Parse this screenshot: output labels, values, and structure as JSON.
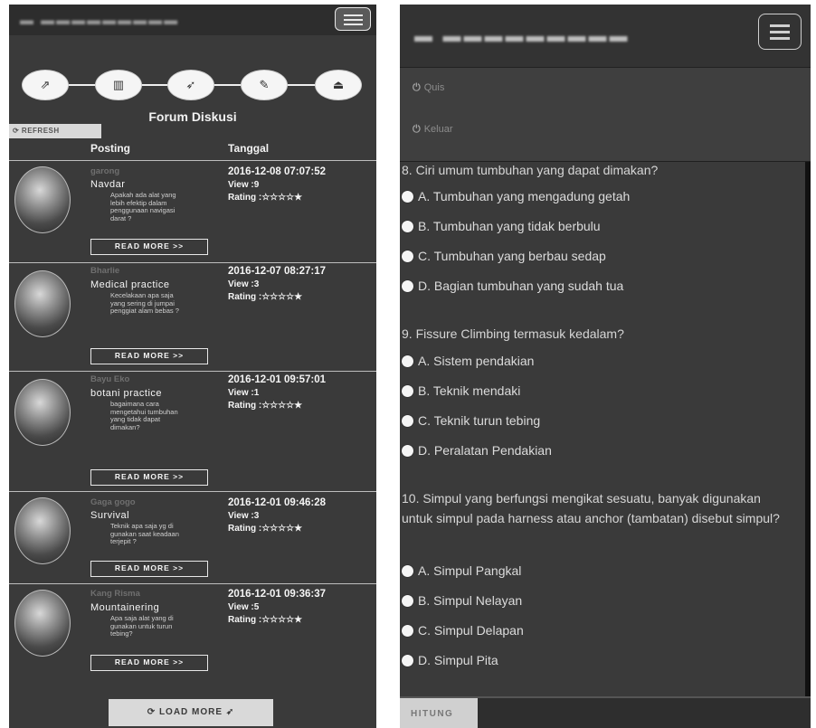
{
  "forum": {
    "menu_icon": "hamburger-icon",
    "steps": [
      {
        "icon": "folder-open-icon",
        "glyph": "⇗"
      },
      {
        "icon": "bank-icon",
        "glyph": "▥"
      },
      {
        "icon": "paper-plane-icon",
        "glyph": "➶"
      },
      {
        "icon": "pencil-icon",
        "glyph": "✎"
      },
      {
        "icon": "eject-icon",
        "glyph": "⏏"
      }
    ],
    "title": "Forum Diskusi",
    "refresh_label": "⟳ REFRESH",
    "col_posting": "Posting",
    "col_tanggal": "Tanggal",
    "posts": [
      {
        "author": "garong",
        "title": "Navdar",
        "body": "Apakah ada alat yang lebih efektip dalam penggunaan navigasi darat ?",
        "date": "2016-12-08 07:07:52",
        "view": "View :9",
        "rating": "Rating :☆☆☆☆★",
        "read_more": "READ MORE >>"
      },
      {
        "author": "Bharlie",
        "title": "Medical practice",
        "body": "Kecelakaan apa saja yang sering di jumpai penggiat alam bebas ?",
        "date": "2016-12-07 08:27:17",
        "view": "View :3",
        "rating": "Rating :☆☆☆☆★",
        "read_more": "READ MORE >>"
      },
      {
        "author": "Bayu Eko",
        "title": "botani practice",
        "body": "bagaimana cara mengetahui tumbuhan yang tidak dapat dimakan?",
        "date": "2016-12-01 09:57:01",
        "view": "View :1",
        "rating": "Rating :☆☆☆☆★",
        "read_more": "READ MORE >>"
      },
      {
        "author": "Gaga gogo",
        "title": "Survival",
        "body": "Teknik apa saja yg di gunakan saat keadaan terjepit ?",
        "date": "2016-12-01 09:46:28",
        "view": "View :3",
        "rating": "Rating :☆☆☆☆★",
        "read_more": "READ MORE >>"
      },
      {
        "author": "Kang Risma",
        "title": "Mountainering",
        "body": "Apa saja alat yang di gunakan untuk turun tebing?",
        "date": "2016-12-01 09:36:37",
        "view": "View :5",
        "rating": "Rating :☆☆☆☆★",
        "read_more": "READ MORE >>"
      }
    ],
    "load_more": "⟳ LOAD MORE ➶"
  },
  "quiz": {
    "menu_icon": "hamburger-icon",
    "menu_items": [
      {
        "icon": "power-icon",
        "glyph": "⏻",
        "label": "Quis"
      },
      {
        "icon": "power-icon",
        "glyph": "⏻",
        "label": "Keluar"
      }
    ],
    "questions": [
      {
        "text": "8. Ciri umum tumbuhan yang dapat dimakan?",
        "options": [
          "A. Tumbuhan yang mengadung getah",
          "B. Tumbuhan yang tidak berbulu",
          "C. Tumbuhan yang berbau sedap",
          "D. Bagian tumbuhan yang sudah tua"
        ]
      },
      {
        "text": "9. Fissure Climbing termasuk kedalam?",
        "options": [
          "A. Sistem pendakian",
          "B. Teknik mendaki",
          "C. Teknik turun tebing",
          "D. Peralatan Pendakian"
        ]
      },
      {
        "text": "10. Simpul yang berfungsi mengikat sesuatu, banyak digunakan untuk simpul pada harness atau anchor (tambatan) disebut simpul?",
        "options": [
          "A. Simpul Pangkal",
          "B. Simpul Nelayan",
          "C. Simpul Delapan",
          "D. Simpul Pita"
        ]
      }
    ],
    "submit_label": "HITUNG"
  }
}
